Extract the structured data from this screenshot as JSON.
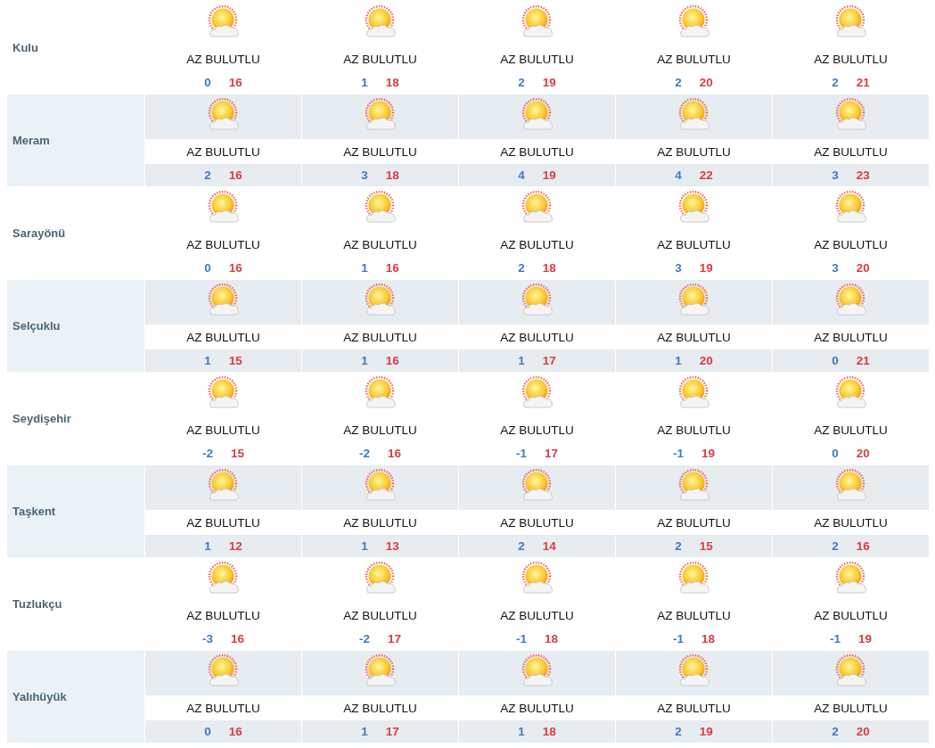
{
  "cities": [
    {
      "name": "Kulu",
      "days": [
        {
          "condition": "AZ BULUTLU",
          "low": "0",
          "high": "16"
        },
        {
          "condition": "AZ BULUTLU",
          "low": "1",
          "high": "18"
        },
        {
          "condition": "AZ BULUTLU",
          "low": "2",
          "high": "19"
        },
        {
          "condition": "AZ BULUTLU",
          "low": "2",
          "high": "20"
        },
        {
          "condition": "AZ BULUTLU",
          "low": "2",
          "high": "21"
        }
      ]
    },
    {
      "name": "Meram",
      "days": [
        {
          "condition": "AZ BULUTLU",
          "low": "2",
          "high": "16"
        },
        {
          "condition": "AZ BULUTLU",
          "low": "3",
          "high": "18"
        },
        {
          "condition": "AZ BULUTLU",
          "low": "4",
          "high": "19"
        },
        {
          "condition": "AZ BULUTLU",
          "low": "4",
          "high": "22"
        },
        {
          "condition": "AZ BULUTLU",
          "low": "3",
          "high": "23"
        }
      ]
    },
    {
      "name": "Sarayönü",
      "days": [
        {
          "condition": "AZ BULUTLU",
          "low": "0",
          "high": "16"
        },
        {
          "condition": "AZ BULUTLU",
          "low": "1",
          "high": "16"
        },
        {
          "condition": "AZ BULUTLU",
          "low": "2",
          "high": "18"
        },
        {
          "condition": "AZ BULUTLU",
          "low": "3",
          "high": "19"
        },
        {
          "condition": "AZ BULUTLU",
          "low": "3",
          "high": "20"
        }
      ]
    },
    {
      "name": "Selçuklu",
      "days": [
        {
          "condition": "AZ BULUTLU",
          "low": "1",
          "high": "15"
        },
        {
          "condition": "AZ BULUTLU",
          "low": "1",
          "high": "16"
        },
        {
          "condition": "AZ BULUTLU",
          "low": "1",
          "high": "17"
        },
        {
          "condition": "AZ BULUTLU",
          "low": "1",
          "high": "20"
        },
        {
          "condition": "AZ BULUTLU",
          "low": "0",
          "high": "21"
        }
      ]
    },
    {
      "name": "Seydişehir",
      "days": [
        {
          "condition": "AZ BULUTLU",
          "low": "-2",
          "high": "15"
        },
        {
          "condition": "AZ BULUTLU",
          "low": "-2",
          "high": "16"
        },
        {
          "condition": "AZ BULUTLU",
          "low": "-1",
          "high": "17"
        },
        {
          "condition": "AZ BULUTLU",
          "low": "-1",
          "high": "19"
        },
        {
          "condition": "AZ BULUTLU",
          "low": "0",
          "high": "20"
        }
      ]
    },
    {
      "name": "Taşkent",
      "days": [
        {
          "condition": "AZ BULUTLU",
          "low": "1",
          "high": "12"
        },
        {
          "condition": "AZ BULUTLU",
          "low": "1",
          "high": "13"
        },
        {
          "condition": "AZ BULUTLU",
          "low": "2",
          "high": "14"
        },
        {
          "condition": "AZ BULUTLU",
          "low": "2",
          "high": "15"
        },
        {
          "condition": "AZ BULUTLU",
          "low": "2",
          "high": "16"
        }
      ]
    },
    {
      "name": "Tuzlukçu",
      "days": [
        {
          "condition": "AZ BULUTLU",
          "low": "-3",
          "high": "16"
        },
        {
          "condition": "AZ BULUTLU",
          "low": "-2",
          "high": "17"
        },
        {
          "condition": "AZ BULUTLU",
          "low": "-1",
          "high": "18"
        },
        {
          "condition": "AZ BULUTLU",
          "low": "-1",
          "high": "18"
        },
        {
          "condition": "AZ BULUTLU",
          "low": "-1",
          "high": "19"
        }
      ]
    },
    {
      "name": "Yalıhüyük",
      "days": [
        {
          "condition": "AZ BULUTLU",
          "low": "0",
          "high": "16"
        },
        {
          "condition": "AZ BULUTLU",
          "low": "1",
          "high": "17"
        },
        {
          "condition": "AZ BULUTLU",
          "low": "1",
          "high": "18"
        },
        {
          "condition": "AZ BULUTLU",
          "low": "2",
          "high": "19"
        },
        {
          "condition": "AZ BULUTLU",
          "low": "2",
          "high": "20"
        }
      ]
    }
  ]
}
